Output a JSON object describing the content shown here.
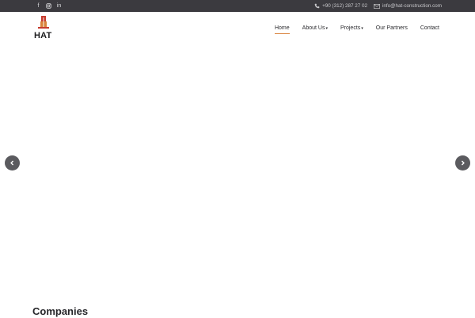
{
  "topbar": {
    "social": [
      {
        "icon": "facebook-icon",
        "glyph": "f"
      },
      {
        "icon": "instagram-icon",
        "glyph": ""
      },
      {
        "icon": "linkedin-icon",
        "glyph": "in"
      }
    ],
    "phone": "+90 (312) 287 27 02",
    "email": "info@hat-construction.com"
  },
  "header": {
    "logo_text": "HAT",
    "nav": [
      {
        "label": "Home",
        "active": true,
        "dropdown": false
      },
      {
        "label": "About Us",
        "active": false,
        "dropdown": true
      },
      {
        "label": "Projects",
        "active": false,
        "dropdown": true
      },
      {
        "label": "Our Partners",
        "active": false,
        "dropdown": false
      },
      {
        "label": "Contact",
        "active": false,
        "dropdown": false
      }
    ],
    "accent_color": "#d9823b"
  },
  "slider": {
    "prev_icon": "chevron-left-icon",
    "next_icon": "chevron-right-icon"
  },
  "section": {
    "title": "Companies"
  }
}
